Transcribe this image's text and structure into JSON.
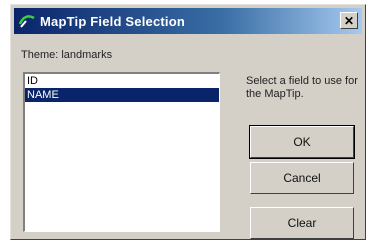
{
  "window": {
    "title": "MapTip Field Selection",
    "close_glyph": "✕",
    "icon": "maptip-app-icon"
  },
  "theme_label": "Theme: landmarks",
  "fields": {
    "items": [
      {
        "label": "ID",
        "selected": false
      },
      {
        "label": "NAME",
        "selected": true
      }
    ]
  },
  "hint": "Select a field to use for the MapTip.",
  "buttons": {
    "ok": "OK",
    "cancel": "Cancel",
    "clear": "Clear"
  },
  "colors": {
    "titlebar": "#0a246a",
    "selection": "#0a246a",
    "dialog_bg": "#d4d0c8"
  }
}
